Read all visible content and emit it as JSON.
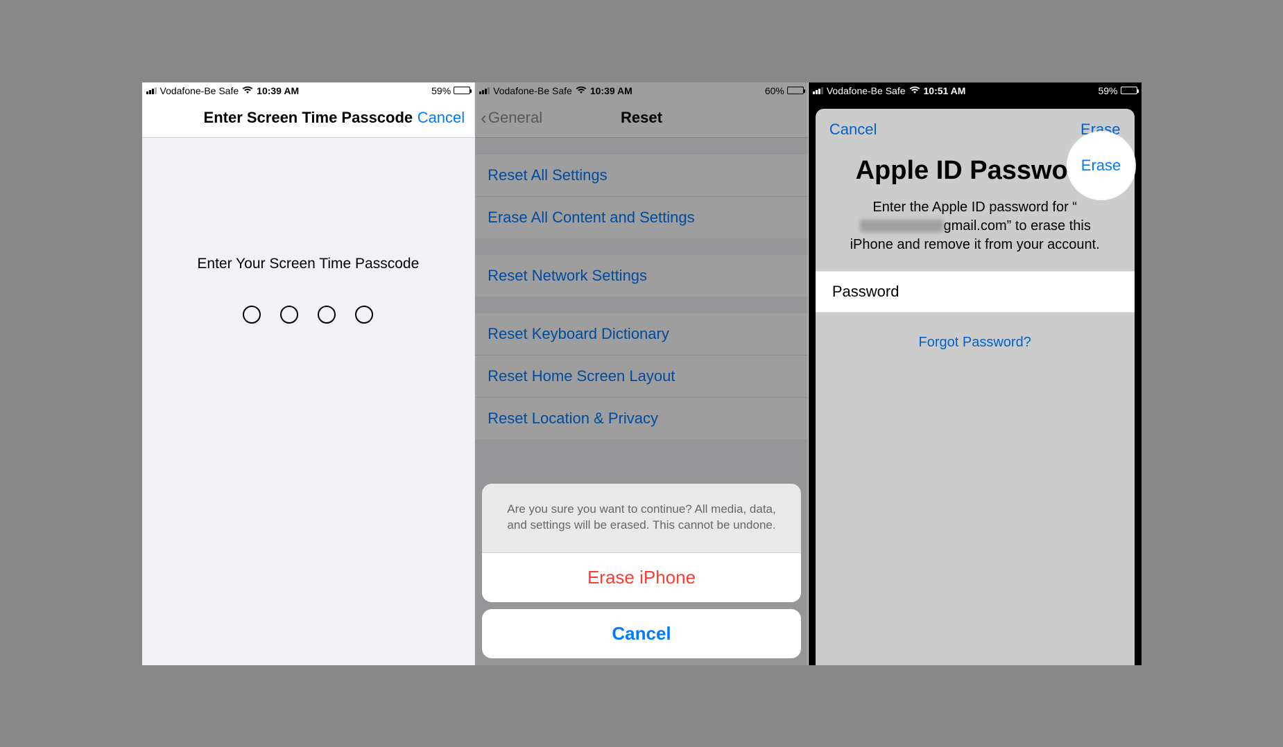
{
  "carrier": "Vodafone-Be Safe",
  "phone1": {
    "time": "10:39 AM",
    "battery_pct": "59%",
    "nav_title": "Enter Screen Time Passcode",
    "nav_cancel": "Cancel",
    "prompt": "Enter Your Screen Time Passcode"
  },
  "phone2": {
    "time": "10:39 AM",
    "battery_pct": "60%",
    "back_label": "General",
    "nav_title": "Reset",
    "rows": [
      "Reset All Settings",
      "Erase All Content and Settings",
      "Reset Network Settings",
      "Reset Keyboard Dictionary",
      "Reset Home Screen Layout",
      "Reset Location & Privacy"
    ],
    "sheet_msg": "Are you sure you want to continue? All media, data, and settings will be erased. This cannot be undone.",
    "sheet_action": "Erase iPhone",
    "sheet_cancel": "Cancel"
  },
  "phone3": {
    "time": "10:51 AM",
    "battery_pct": "59%",
    "cancel": "Cancel",
    "erase": "Erase",
    "title": "Apple ID Password",
    "desc_pre": "Enter the Apple ID password for “",
    "desc_email_suffix": "gmail.com",
    "desc_post": "” to erase this iPhone and remove it from your account.",
    "password_label": "Password",
    "forgot": "Forgot Password?"
  }
}
